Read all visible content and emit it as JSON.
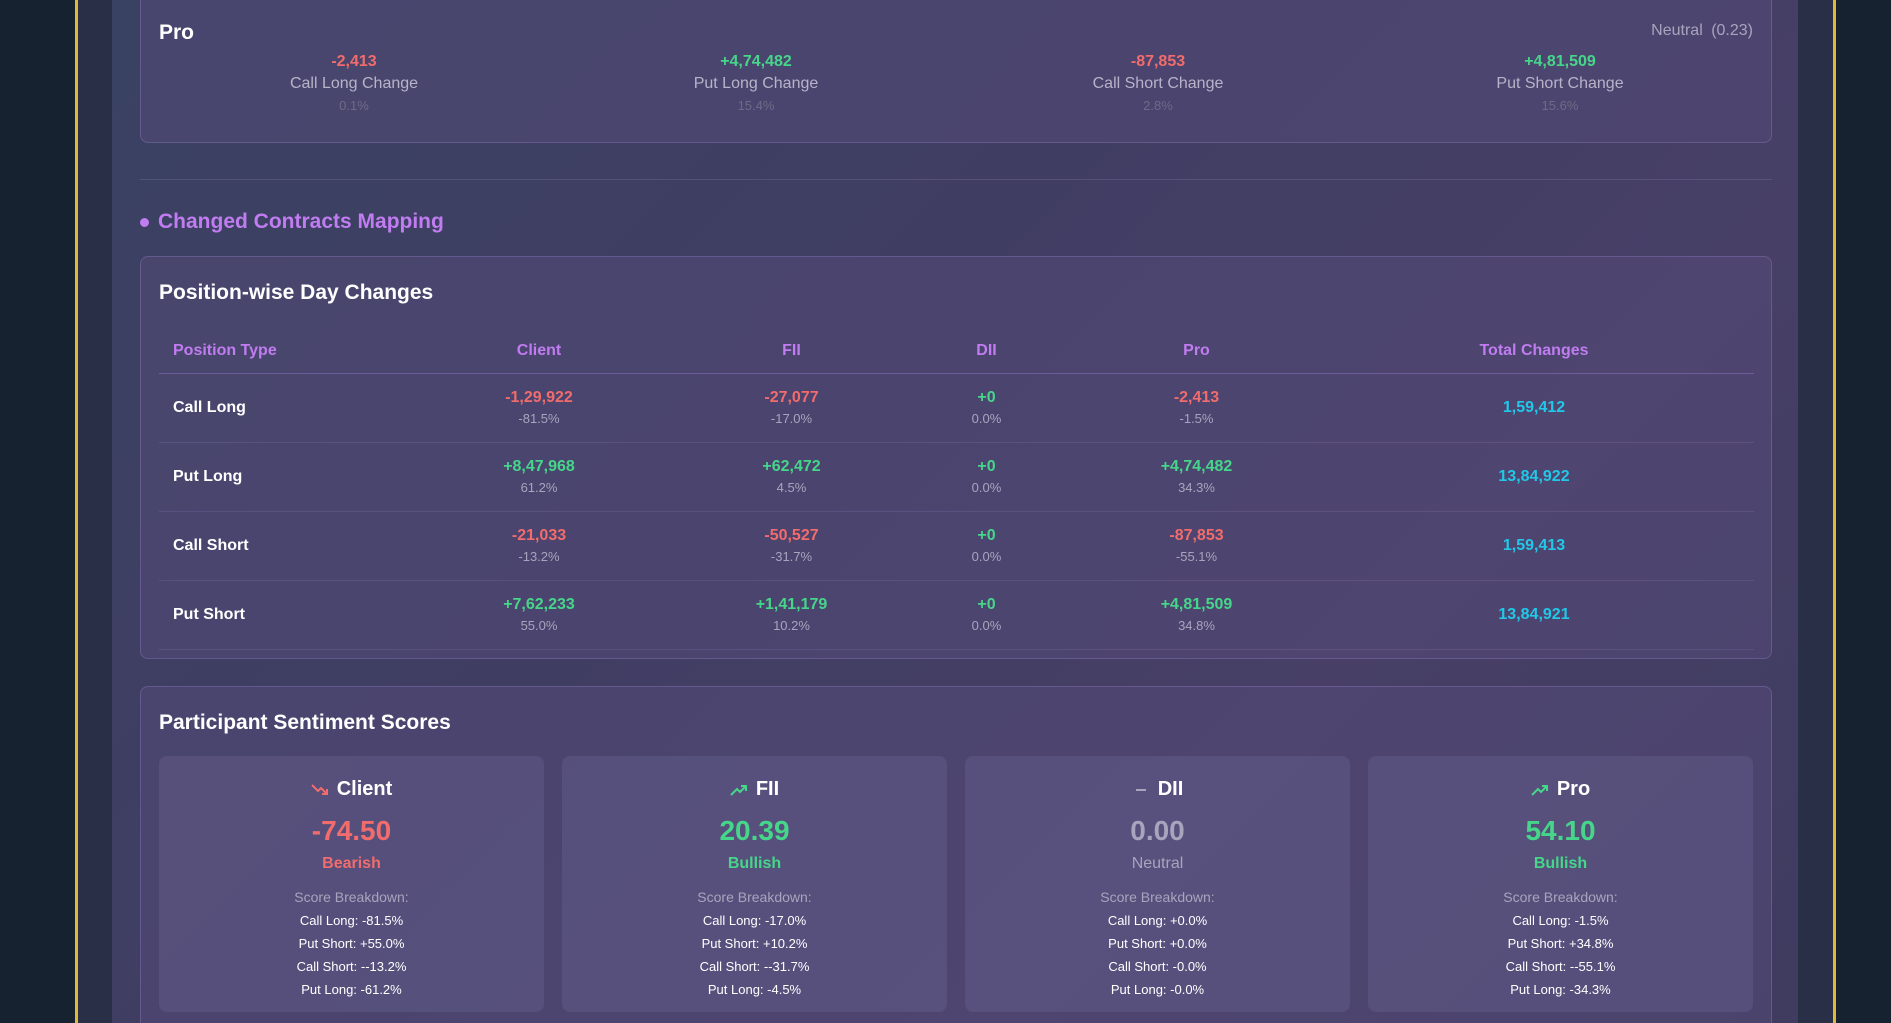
{
  "pro_card": {
    "title": "Pro",
    "status": "Neutral",
    "status_value": "(0.23)",
    "stats": [
      {
        "value": "-2,413",
        "label": "Call Long Change",
        "pct": "0.1%",
        "tone": "neg"
      },
      {
        "value": "+4,74,482",
        "label": "Put Long Change",
        "pct": "15.4%",
        "tone": "pos"
      },
      {
        "value": "-87,853",
        "label": "Call Short Change",
        "pct": "2.8%",
        "tone": "neg"
      },
      {
        "value": "+4,81,509",
        "label": "Put Short Change",
        "pct": "15.6%",
        "tone": "pos"
      }
    ]
  },
  "section": {
    "title": "Changed Contracts Mapping"
  },
  "table": {
    "title": "Position-wise Day Changes",
    "headers": [
      "Position Type",
      "Client",
      "FII",
      "DII",
      "Pro",
      "Total Changes"
    ],
    "rows": [
      {
        "type": "Call Long",
        "client": {
          "v": "-1,29,922",
          "p": "-81.5%"
        },
        "fii": {
          "v": "-27,077",
          "p": "-17.0%"
        },
        "dii": {
          "v": "+0",
          "p": "0.0%"
        },
        "pro": {
          "v": "-2,413",
          "p": "-1.5%"
        },
        "total": "1,59,412"
      },
      {
        "type": "Put Long",
        "client": {
          "v": "+8,47,968",
          "p": "61.2%"
        },
        "fii": {
          "v": "+62,472",
          "p": "4.5%"
        },
        "dii": {
          "v": "+0",
          "p": "0.0%"
        },
        "pro": {
          "v": "+4,74,482",
          "p": "34.3%"
        },
        "total": "13,84,922"
      },
      {
        "type": "Call Short",
        "client": {
          "v": "-21,033",
          "p": "-13.2%"
        },
        "fii": {
          "v": "-50,527",
          "p": "-31.7%"
        },
        "dii": {
          "v": "+0",
          "p": "0.0%"
        },
        "pro": {
          "v": "-87,853",
          "p": "-55.1%"
        },
        "total": "1,59,413"
      },
      {
        "type": "Put Short",
        "client": {
          "v": "+7,62,233",
          "p": "55.0%"
        },
        "fii": {
          "v": "+1,41,179",
          "p": "10.2%"
        },
        "dii": {
          "v": "+0",
          "p": "0.0%"
        },
        "pro": {
          "v": "+4,81,509",
          "p": "34.8%"
        },
        "total": "13,84,921"
      }
    ]
  },
  "sentiment": {
    "title": "Participant Sentiment Scores",
    "breakdown_label": "Score Breakdown:",
    "participants": [
      {
        "name": "Client",
        "score": "-74.50",
        "sentiment": "Bearish",
        "icon": "trending-down-icon",
        "lines": [
          "Call Long: -81.5%",
          "Put Short: +55.0%",
          "Call Short: --13.2%",
          "Put Long: -61.2%"
        ]
      },
      {
        "name": "FII",
        "score": "20.39",
        "sentiment": "Bullish",
        "icon": "trending-up-icon",
        "lines": [
          "Call Long: -17.0%",
          "Put Short: +10.2%",
          "Call Short: --31.7%",
          "Put Long: -4.5%"
        ]
      },
      {
        "name": "DII",
        "score": "0.00",
        "sentiment": "Neutral",
        "icon": "minus-icon",
        "lines": [
          "Call Long: +0.0%",
          "Put Short: +0.0%",
          "Call Short: -0.0%",
          "Put Long: -0.0%"
        ]
      },
      {
        "name": "Pro",
        "score": "54.10",
        "sentiment": "Bullish",
        "icon": "trending-up-icon",
        "lines": [
          "Call Long: -1.5%",
          "Put Short: +34.8%",
          "Call Short: --55.1%",
          "Put Long: -34.3%"
        ]
      }
    ]
  },
  "colors": {
    "negative": "#f16c6c",
    "positive": "#46d68a",
    "total": "#22c8e8",
    "accent": "#c07cf0",
    "frame": "#e0b836"
  }
}
